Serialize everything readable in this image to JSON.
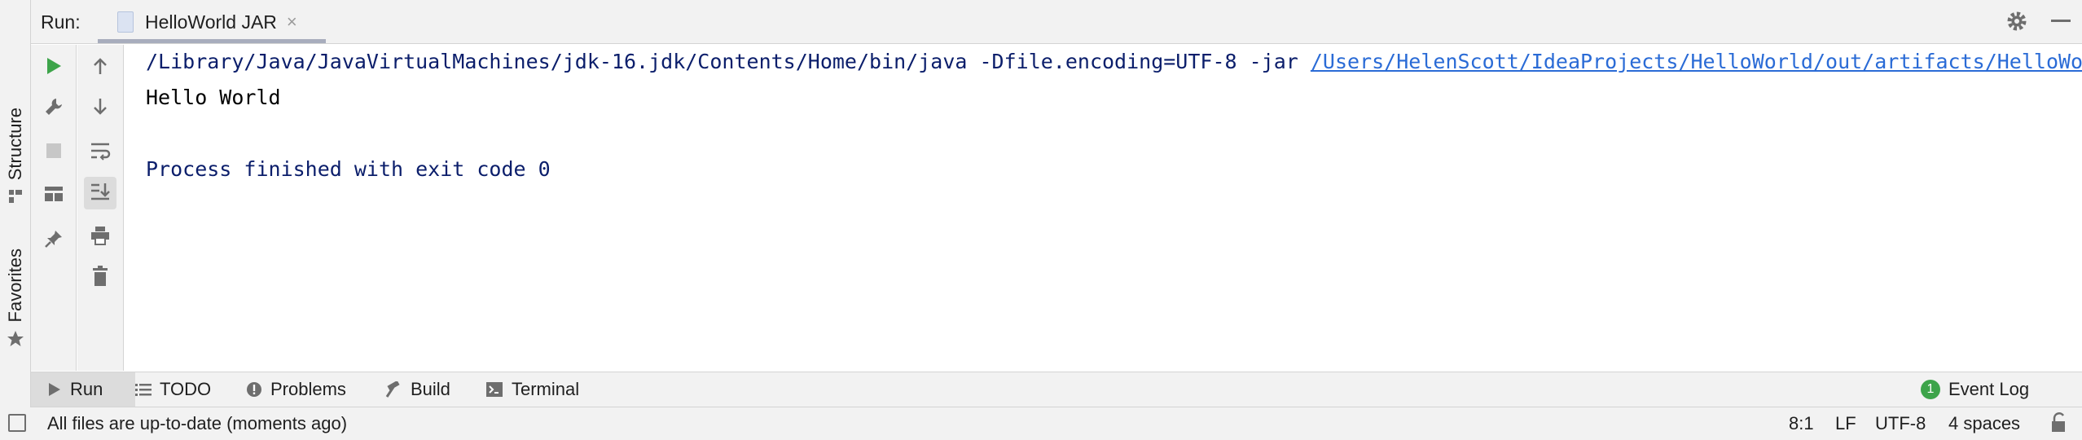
{
  "left_strip": {
    "structure_label": "Structure",
    "favorites_label": "Favorites"
  },
  "run_panel": {
    "run_label": "Run:",
    "tab_title": "HelloWorld JAR",
    "tab_close": "×"
  },
  "toolbar_icons": [
    "run-icon",
    "wrench-icon",
    "stop-icon",
    "layout-icon",
    "pin-icon",
    "arrow-up-icon",
    "arrow-down-icon",
    "soft-wrap-icon",
    "scroll-to-end-icon",
    "print-icon",
    "trash-icon"
  ],
  "console": {
    "command": "/Library/Java/JavaVirtualMachines/jdk-16.jdk/Contents/Home/bin/java -Dfile.encoding=UTF-8 -jar ",
    "jar_link": "/Users/HelenScott/IdeaProjects/HelloWorld/out/artifacts/HelloWorld_jar/HelloWorld.jar",
    "output": "Hello World",
    "exit": "Process finished with exit code 0"
  },
  "bottom_tabs": {
    "run": "Run",
    "todo": "TODO",
    "problems": "Problems",
    "build": "Build",
    "terminal": "Terminal",
    "event_log": "Event Log",
    "event_count": "1"
  },
  "status_bar": {
    "message": "All files are up-to-date (moments ago)",
    "position": "8:1",
    "line_sep": "LF",
    "encoding": "UTF-8",
    "indent": "4 spaces"
  },
  "colors": {
    "run_green": "#3da44a",
    "console_blue": "#0b1e6b",
    "link_blue": "#2a6bd6",
    "panel_bg": "#f2f2f2"
  }
}
